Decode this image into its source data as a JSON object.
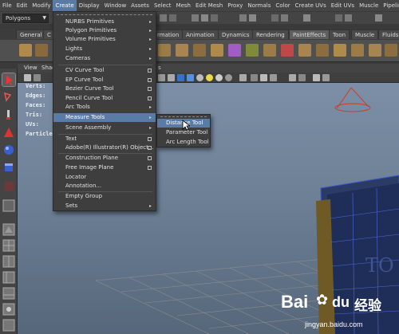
{
  "menubar": [
    "File",
    "Edit",
    "Modify",
    "Create",
    "Display",
    "Window",
    "Assets",
    "Select",
    "Mesh",
    "Edit Mesh",
    "Proxy",
    "Normals",
    "Color",
    "Create UVs",
    "Edit UVs",
    "Muscle",
    "Pipeline"
  ],
  "menubar_active": "Create",
  "mode_selector": "Polygons",
  "shelf_tabs": [
    "General",
    "C",
    "rmation",
    "Animation",
    "Dynamics",
    "Rendering",
    "PaintEffects",
    "Toon",
    "Muscle",
    "Fluids"
  ],
  "shelf_tab_selected": "Polygons",
  "viewport_menu": [
    "View",
    "Shad"
  ],
  "viewport_menu_extra": "s",
  "hud_labels": [
    "Verts:",
    "Edges:",
    "Faces:",
    "Tris:",
    "UVs:",
    "Particle"
  ],
  "create_menu": {
    "items": [
      {
        "label": "NURBS Primitives",
        "type": "submenu"
      },
      {
        "label": "Polygon Primitives",
        "type": "submenu"
      },
      {
        "label": "Volume Primitives",
        "type": "submenu"
      },
      {
        "label": "Lights",
        "type": "submenu"
      },
      {
        "label": "Cameras",
        "type": "submenu"
      },
      {
        "label": "CV Curve Tool",
        "type": "option"
      },
      {
        "label": "EP Curve Tool",
        "type": "option"
      },
      {
        "label": "Bezier Curve Tool",
        "type": "option"
      },
      {
        "label": "Pencil Curve Tool",
        "type": "option"
      },
      {
        "label": "Arc Tools",
        "type": "submenu"
      },
      {
        "label": "Measure Tools",
        "type": "submenu",
        "highlighted": true
      },
      {
        "label": "Scene Assembly",
        "type": "submenu"
      },
      {
        "label": "Text",
        "type": "option"
      },
      {
        "label": "Adobe(R) Illustrator(R) Object...",
        "type": "option"
      },
      {
        "label": "Construction Plane",
        "type": "option"
      },
      {
        "label": "Free Image Plane",
        "type": "option"
      },
      {
        "label": "Locator",
        "type": "plain"
      },
      {
        "label": "Annotation...",
        "type": "plain"
      },
      {
        "label": "Empty Group",
        "type": "plain"
      },
      {
        "label": "Sets",
        "type": "submenu"
      }
    ]
  },
  "measure_submenu": {
    "items": [
      {
        "label": "Distance Tool",
        "highlighted": true
      },
      {
        "label": "Parameter Tool"
      },
      {
        "label": "Arc Length Tool"
      }
    ]
  },
  "viewport_text": "TO",
  "watermark": {
    "brand": "Bai",
    "paw": "du",
    "cn": "经验",
    "url": "jingyan.baidu.com"
  },
  "colors": {
    "accent_highlight": "#5a7ba6",
    "menu_bg": "#3e3e3e",
    "viewport_top": "#7c8fa6",
    "viewport_bottom": "#56677a"
  }
}
